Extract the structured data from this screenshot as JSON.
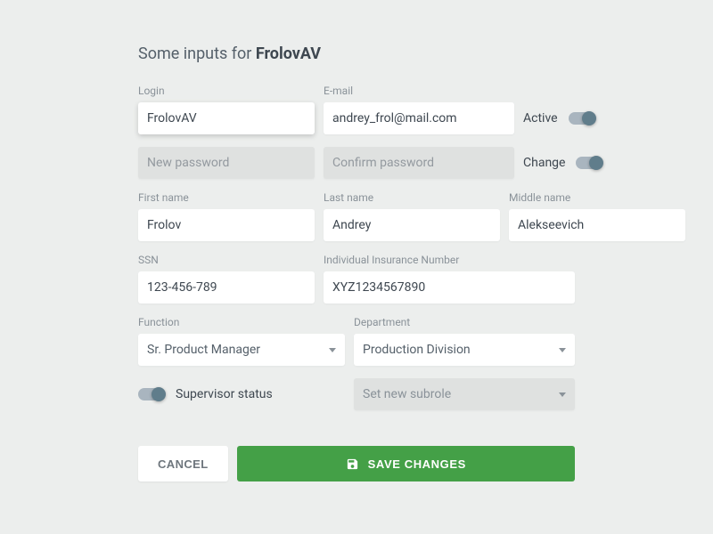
{
  "title_prefix": "Some inputs for ",
  "title_bold": "FrolovAV",
  "labels": {
    "login": "Login",
    "email": "E-mail",
    "active": "Active",
    "new_password": "New password",
    "confirm_password": "Confirm password",
    "change": "Change",
    "first_name": "First name",
    "last_name": "Last name",
    "middle_name": "Middle name",
    "ssn": "SSN",
    "iin": "Individual Insurance Number",
    "function": "Function",
    "department": "Department",
    "supervisor": "Supervisor status",
    "subrole_placeholder": "Set new subrole"
  },
  "values": {
    "login": "FrolovAV",
    "email": "andrey_frol@mail.com",
    "first_name": "Frolov",
    "last_name": "Andrey",
    "middle_name": "Alekseevich",
    "ssn": "123-456-789",
    "iin": "XYZ1234567890",
    "function": "Sr. Product Manager",
    "department": "Production Division"
  },
  "buttons": {
    "cancel": "CANCEL",
    "save": "SAVE CHANGES"
  },
  "toggles": {
    "active": true,
    "change": true,
    "supervisor": true
  }
}
